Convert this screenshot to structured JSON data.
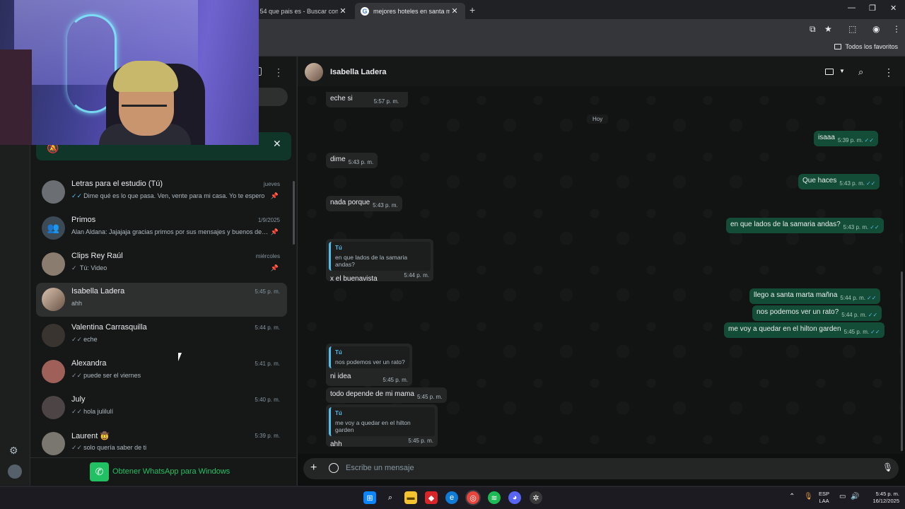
{
  "browser": {
    "tabs": [
      {
        "title": "mas 54 que pais es - Buscar con"
      },
      {
        "title": "mejores hoteles en santa marta"
      }
    ],
    "new_tab": "+",
    "bookmarks_label": "Todos los favoritos"
  },
  "chat_list": {
    "chats": [
      {
        "name": "Letras para el estudio (Tú)",
        "time": "jueves",
        "preview": "Dime qué es lo que pasa. Ven, vente para mi casa. Yo te espero",
        "ticks": "✓✓",
        "pinned": true
      },
      {
        "name": "Primos",
        "time": "1/9/2025",
        "preview": "Alan Aldana: Jajajaja gracias primos por sus mensajes y buenos deseos",
        "ticks": "",
        "pinned": true
      },
      {
        "name": "Clips Rey Raúl",
        "time": "miércoles",
        "preview": "Tú: Video",
        "ticks": "✓",
        "pinned": true
      },
      {
        "name": "Isabella  Ladera",
        "time": "5:45 p. m.",
        "preview": "ahh",
        "ticks": "",
        "pinned": false
      },
      {
        "name": "Valentina Carrasquilla",
        "time": "5:44 p. m.",
        "preview": "eche",
        "ticks": "✓✓",
        "pinned": false
      },
      {
        "name": "Alexandra",
        "time": "5:41 p. m.",
        "preview": "puede ser el viernes",
        "ticks": "✓✓",
        "pinned": false
      },
      {
        "name": "July",
        "time": "5:40 p. m.",
        "preview": "hola julilulí",
        "ticks": "✓✓",
        "pinned": false
      },
      {
        "name": "Laurent 🤠",
        "time": "5:39 p. m.",
        "preview": "solo quería saber de ti",
        "ticks": "✓✓",
        "pinned": false
      }
    ],
    "get_whatsapp": "Obtener WhatsApp para Windows"
  },
  "chat": {
    "contact_name": "Isabella  Ladera",
    "day_label": "Hoy",
    "messages": [
      {
        "dir": "in",
        "text": "eche si",
        "time": "5:57 p. m."
      },
      {
        "dir": "out",
        "text": "isaaa",
        "time": "5:39 p. m."
      },
      {
        "dir": "in",
        "text": "dime",
        "time": "5:43 p. m."
      },
      {
        "dir": "out",
        "text": "Que haces",
        "time": "5:43 p. m."
      },
      {
        "dir": "in",
        "text": "nada porque",
        "time": "5:43 p. m."
      },
      {
        "dir": "out",
        "text": "en que lados de la samaria andas?",
        "time": "5:43 p. m."
      },
      {
        "dir": "in",
        "quote_author": "Tú",
        "quote_text": "en que lados de la samaria andas?",
        "text": "x el buenavista",
        "time": "5:44 p. m."
      },
      {
        "dir": "out",
        "text": "llego a santa marta mañna",
        "time": "5:44 p. m."
      },
      {
        "dir": "out",
        "text": "nos podemos ver un rato?",
        "time": "5:44 p. m."
      },
      {
        "dir": "out",
        "text": "me voy a quedar en el hilton garden",
        "time": "5:45 p. m."
      },
      {
        "dir": "in",
        "quote_author": "Tú",
        "quote_text": "nos podemos ver un rato?",
        "text": "ni idea",
        "time": "5:45 p. m."
      },
      {
        "dir": "in",
        "text": "todo depende de mi mama",
        "time": "5:45 p. m."
      },
      {
        "dir": "in",
        "quote_author": "Tú",
        "quote_text": "me voy a quedar en el hilton garden",
        "text": "ahh",
        "time": "5:45 p. m."
      }
    ],
    "read_ticks": "✓✓",
    "composer_placeholder": "Escribe un mensaje"
  },
  "taskbar": {
    "lang_line1": "ESP",
    "lang_line2": "LAA",
    "clock_time": "5:45 p. m.",
    "clock_date": "16/12/2025"
  },
  "colors": {
    "accent": "#21c063",
    "outgoing_bubble": "#144d37",
    "incoming_bubble": "#242626",
    "read_tick": "#53bdeb"
  }
}
